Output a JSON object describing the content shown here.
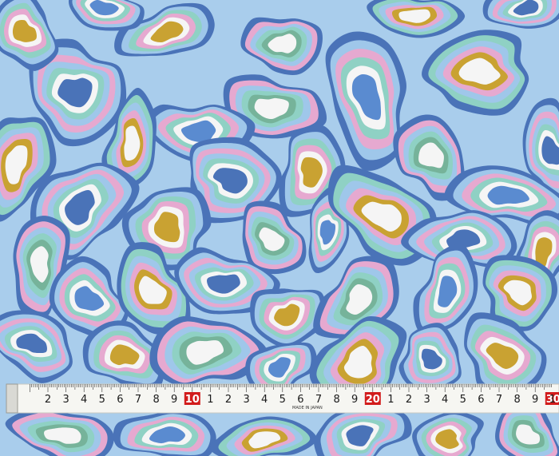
{
  "fabric": {
    "base_color": "#a9cdec",
    "ring_colors": [
      "#4a73b8",
      "#9fc7ea",
      "#e6a9d0",
      "#8fd1c4",
      "#f5f5f5",
      "#c9a232",
      "#76b39a",
      "#5a8bd0"
    ]
  },
  "tape": {
    "marks": [
      "2",
      "3",
      "4",
      "5",
      "6",
      "7",
      "8",
      "9",
      "10",
      "1",
      "2",
      "3",
      "4",
      "5",
      "6",
      "7",
      "8",
      "9",
      "20",
      "1",
      "2",
      "3",
      "4",
      "5",
      "6",
      "7",
      "8",
      "9",
      "30"
    ],
    "maker_text": "MADE IN JAPAN",
    "end_fragment": "1"
  }
}
